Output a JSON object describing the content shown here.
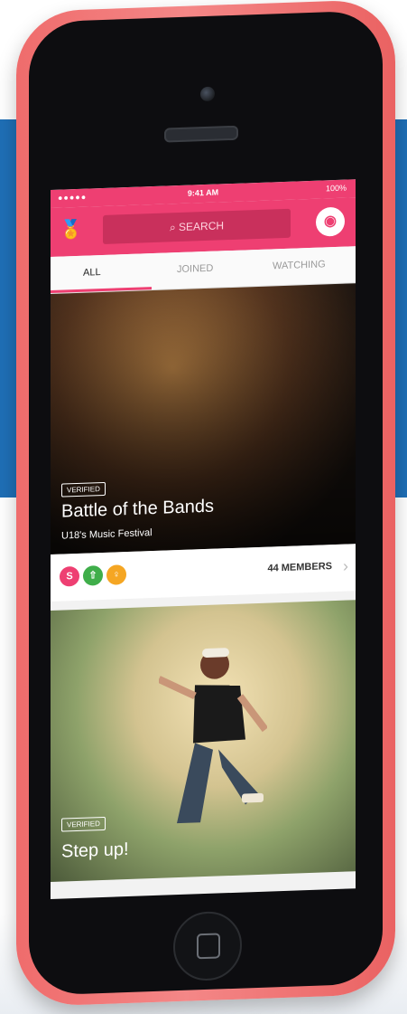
{
  "status_bar": {
    "signal": "●●●●● ",
    "time": "9:41 AM",
    "battery": "100%"
  },
  "nav": {
    "search_placeholder": "SEARCH"
  },
  "tabs": [
    {
      "label": "ALL",
      "active": true
    },
    {
      "label": "JOINED",
      "active": false
    },
    {
      "label": "WATCHING",
      "active": false
    }
  ],
  "cards": [
    {
      "badge": "VERIFIED",
      "title": "Battle of the Bands",
      "subtitle": "U18's Music Festival",
      "members": "44 MEMBERS",
      "avatars": [
        {
          "letter": "S",
          "color": "#ee3f72"
        },
        {
          "letter": "⇧",
          "color": "#3fae4a"
        },
        {
          "letter": "♀",
          "color": "#f5a623"
        }
      ]
    },
    {
      "badge": "VERIFIED",
      "title": "Step up!"
    }
  ],
  "colors": {
    "accent": "#ee3f72",
    "phone_case": "#f07070",
    "background_band": "#1f6fb6"
  }
}
